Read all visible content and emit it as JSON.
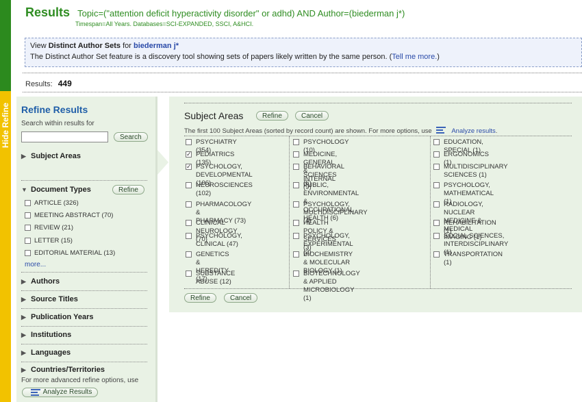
{
  "hide_refine_label": "Hide Refine",
  "header": {
    "title": "Results",
    "query": "Topic=(\"attention deficit hyperactivity disorder\" or adhd) AND Author=(biederman j*)",
    "timespan": "Timespan=All Years. Databases=SCI-EXPANDED, SSCI, A&HCI."
  },
  "distinct": {
    "prefix": "View",
    "label": "Distinct Author Sets",
    "for": "for",
    "author": "biederman j*",
    "description": "The Distinct Author Set feature is a discovery tool showing sets of papers likely written by the same person. (",
    "tell_more": "Tell me more.",
    "close_paren": ")"
  },
  "results": {
    "label": "Results:",
    "count": "449"
  },
  "sidebar": {
    "title": "Refine Results",
    "search_label": "Search within results for",
    "search_value": "",
    "search_button": "Search",
    "subject_areas": "Subject Areas",
    "document_types": "Document Types",
    "refine_button": "Refine",
    "doc_types": [
      {
        "label": "ARTICLE (326)",
        "checked": false
      },
      {
        "label": "MEETING ABSTRACT (70)",
        "checked": false
      },
      {
        "label": "REVIEW (21)",
        "checked": false
      },
      {
        "label": "LETTER (15)",
        "checked": false
      },
      {
        "label": "EDITORIAL MATERIAL (13)",
        "checked": false
      }
    ],
    "more": "more...",
    "sections": [
      "Authors",
      "Source Titles",
      "Publication Years",
      "Institutions",
      "Languages",
      "Countries/Territories"
    ],
    "advanced_text": "For more advanced refine options, use",
    "analyze_button": "Analyze Results"
  },
  "panel": {
    "title": "Subject Areas",
    "refine_button": "Refine",
    "cancel_button": "Cancel",
    "info": "The first 100 Subject Areas (sorted by record count) are shown. For more options, use",
    "analyze_link": "Analyze results",
    "info_end": ".",
    "col1": [
      {
        "label": "PSYCHIATRY (354)",
        "checked": false
      },
      {
        "label": "PEDIATRICS (135)",
        "checked": true
      },
      {
        "label": "PSYCHOLOGY,",
        "label2": "DEVELOPMENTAL (106)",
        "checked": true
      },
      {
        "label": "NEUROSCIENCES (102)",
        "checked": false
      },
      {
        "label": "PHARMACOLOGY &",
        "label2": "PHARMACY (73)",
        "checked": false
      },
      {
        "label": "CLINICAL NEUROLOGY (70)",
        "checked": false
      },
      {
        "label": "PSYCHOLOGY, CLINICAL (47)",
        "checked": false
      },
      {
        "label": "GENETICS & HEREDITY (17)",
        "checked": false
      },
      {
        "label": "SUBSTANCE ABUSE (12)",
        "checked": false
      }
    ],
    "col2": [
      {
        "label": "PSYCHOLOGY (10)",
        "checked": false
      },
      {
        "label": "MEDICINE, GENERAL & INTERNAL (9)",
        "checked": false
      },
      {
        "label": "BEHAVIORAL SCIENCES (6)",
        "checked": false
      },
      {
        "label": "PUBLIC, ENVIRONMENTAL &",
        "label2": "OCCUPATIONAL HEALTH (6)",
        "checked": false
      },
      {
        "label": "PSYCHOLOGY, MULTIDISCIPLINARY (4)",
        "checked": false
      },
      {
        "label": "HEALTH POLICY & SERVICES (3)",
        "checked": false
      },
      {
        "label": "PSYCHOLOGY, EXPERIMENTAL (2)",
        "checked": false
      },
      {
        "label": "BIOCHEMISTRY & MOLECULAR",
        "label2": "BIOLOGY (1)",
        "checked": false
      },
      {
        "label": "BIOTECHNOLOGY & APPLIED",
        "label2": "MICROBIOLOGY (1)",
        "checked": false
      }
    ],
    "col3": [
      {
        "label": "EDUCATION, SPECIAL (1)",
        "checked": false
      },
      {
        "label": "ERGONOMICS (1)",
        "checked": false
      },
      {
        "label": "MULTIDISCIPLINARY SCIENCES (1)",
        "checked": false
      },
      {
        "label": "PSYCHOLOGY, MATHEMATICAL (1)",
        "checked": false
      },
      {
        "label": "RADIOLOGY, NUCLEAR MEDICINE &",
        "label2": "MEDICAL IMAGING (1)",
        "checked": false
      },
      {
        "label": "REHABILITATION (1)",
        "checked": false
      },
      {
        "label": "SOCIAL SCIENCES, INTERDISCIPLINARY",
        "label2": "(1)",
        "checked": false
      },
      {
        "label": "TRANSPORTATION (1)",
        "checked": false
      }
    ]
  }
}
